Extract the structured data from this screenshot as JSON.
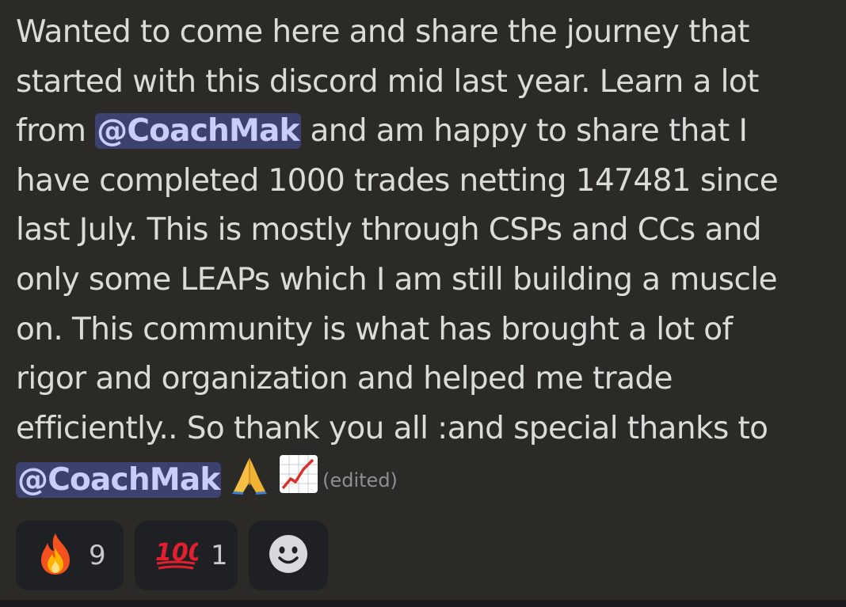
{
  "message": {
    "line1": "Wanted to come here and share the journey that",
    "line2": "started with this discord mid last year. Learn a lot",
    "line3_pre": "from ",
    "mention1": "@CoachMak",
    "line3_post": " and am happy to share that I",
    "line4": "have completed 1000 trades netting 147481 since",
    "line5": "last July. This is mostly through CSPs and CCs and",
    "line6": "only some LEAPs which I am still building a muscle",
    "line7": "on. This community is what has brought a lot of",
    "line8": "rigor and organization and helped me trade",
    "line9": "efficiently.. So thank you all :and special thanks to",
    "mention2": "@CoachMak",
    "emojis": [
      "folded-hands-icon",
      "chart-increasing-icon"
    ],
    "edited_label": "(edited)"
  },
  "reactions": [
    {
      "icon": "fire-icon",
      "count": "9"
    },
    {
      "icon": "hundred-points-icon",
      "count": "1"
    },
    {
      "icon": "add-reaction-smiley-icon"
    }
  ],
  "colors": {
    "background": "#2b2a27",
    "mention_bg": "#3c4270",
    "mention_text": "#c9cdfb",
    "reaction_bg": "#1f2024"
  }
}
